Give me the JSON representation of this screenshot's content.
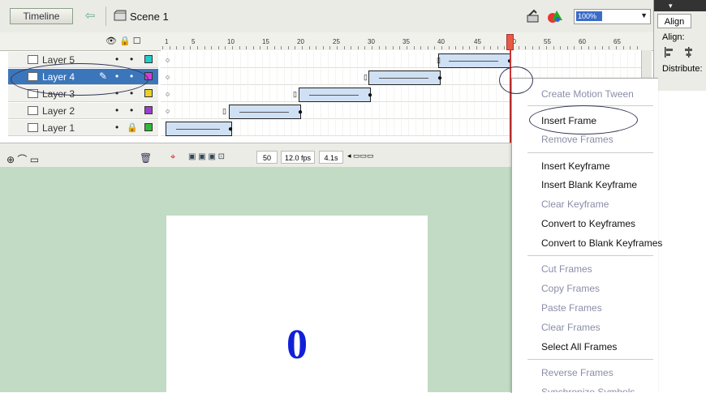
{
  "toolbar": {
    "timeline_button": "Timeline",
    "back_arrow": "⇦",
    "scene_label": "Scene 1",
    "zoom": "100%"
  },
  "panel": {
    "tab": "Align",
    "align_label": "Align:",
    "distribute_label": "Distribute:"
  },
  "ruler": {
    "icons": "👁 🔒 ☐",
    "ticks": [
      "1",
      "5",
      "10",
      "15",
      "20",
      "25",
      "30",
      "35",
      "40",
      "45",
      "50",
      "55",
      "60",
      "65"
    ]
  },
  "layers": [
    {
      "name": "Layer 5",
      "color": "#22cccc"
    },
    {
      "name": "Layer 4",
      "color": "#d83bd8",
      "selected": true
    },
    {
      "name": "Layer 3",
      "color": "#e8d22a"
    },
    {
      "name": "Layer 2",
      "color": "#9b3fd0"
    },
    {
      "name": "Layer 1",
      "color": "#2fba3a"
    }
  ],
  "status": {
    "layer_tools": "⊕ ⌒ ▭",
    "trash": "🗑",
    "frame": "50",
    "fps": "12.0 fps",
    "time": "4.1s"
  },
  "stage": {
    "text": "0",
    "background": "#c2dbc4",
    "text_color": "#1020d8"
  },
  "context_menu": {
    "items": [
      {
        "label": "Create Motion Tween",
        "enabled": false
      },
      {
        "label": "Insert Frame",
        "enabled": true
      },
      {
        "label": "Remove Frames",
        "enabled": false
      },
      {
        "label": "Insert Keyframe",
        "enabled": true
      },
      {
        "label": "Insert Blank Keyframe",
        "enabled": true
      },
      {
        "label": "Clear Keyframe",
        "enabled": false
      },
      {
        "label": "Convert to Keyframes",
        "enabled": true
      },
      {
        "label": "Convert to Blank Keyframes",
        "enabled": true
      },
      {
        "label": "Cut Frames",
        "enabled": false
      },
      {
        "label": "Copy Frames",
        "enabled": false
      },
      {
        "label": "Paste Frames",
        "enabled": false
      },
      {
        "label": "Clear Frames",
        "enabled": false
      },
      {
        "label": "Select All Frames",
        "enabled": true
      },
      {
        "label": "Reverse Frames",
        "enabled": false
      },
      {
        "label": "Synchronize Symbols",
        "enabled": false
      }
    ]
  }
}
